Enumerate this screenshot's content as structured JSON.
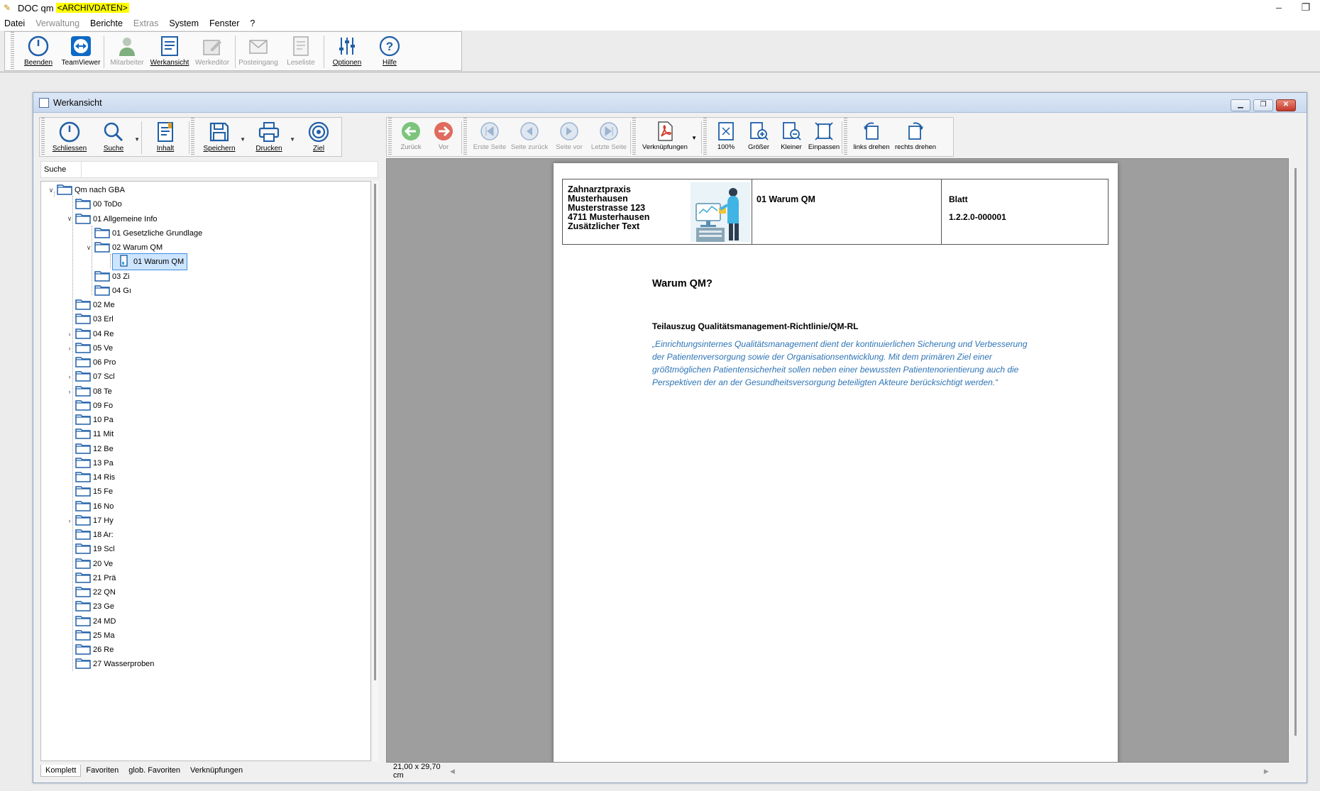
{
  "app": {
    "title": "DOC qm",
    "archive_badge": "<ARCHIVDATEN>",
    "window_controls": [
      "–",
      "❐"
    ]
  },
  "menu": [
    {
      "label": "Datei",
      "disabled": false
    },
    {
      "label": "Verwaltung",
      "disabled": true
    },
    {
      "label": "Berichte",
      "disabled": false
    },
    {
      "label": "Extras",
      "disabled": true
    },
    {
      "label": "System",
      "disabled": false
    },
    {
      "label": "Fenster",
      "disabled": false
    },
    {
      "label": "?",
      "disabled": false
    }
  ],
  "main_toolbar": {
    "beenden": "Beenden",
    "teamviewer": "TeamViewer",
    "mitarbeiter": "Mitarbeiter",
    "werkansicht": "Werkansicht",
    "werkeditor": "Werkeditor",
    "posteingang": "Posteingang",
    "leseliste": "Leseliste",
    "optionen": "Optionen",
    "hilfe": "Hilfe"
  },
  "child_window": {
    "title": "Werkansicht",
    "controls": {
      "minimize": "▁",
      "restore": "❐",
      "close": "✕"
    }
  },
  "left_toolbar": {
    "schliessen": "Schliessen",
    "suche": "Suche",
    "inhalt": "Inhalt",
    "speichern": "Speichern",
    "drucken": "Drucken",
    "ziel": "Ziel"
  },
  "right_toolbar": {
    "zurueck": "Zurück",
    "vor": "Vor",
    "erste_seite": "Erste Seite",
    "seite_zurueck": "Seite zurück",
    "seite_vor": "Seite vor",
    "letzte_seite": "Letzte Seite",
    "verknuepfungen": "Verknüpfungen",
    "zoom100": "100%",
    "groesser": "Größer",
    "kleiner": "Kleiner",
    "einpassen": "Einpassen",
    "links_drehen": "links drehen",
    "rechts_drehen": "rechts drehen"
  },
  "search": {
    "label": "Suche",
    "value": "",
    "placeholder": ""
  },
  "tree": [
    {
      "label": "Qm nach GBA",
      "level": 0,
      "expander": "v"
    },
    {
      "label": "00 ToDo",
      "level": 1,
      "expander": ""
    },
    {
      "label": "01 Allgemeine Info",
      "level": 1,
      "expander": "v"
    },
    {
      "label": "01 Gesetzliche Grundlage",
      "level": 2,
      "expander": ""
    },
    {
      "label": "02 Warum QM",
      "level": 2,
      "expander": "v"
    },
    {
      "label": "01 Warum QM",
      "level": 3,
      "expander": "",
      "doc": true,
      "selected": true
    },
    {
      "label": "03 Zi",
      "level": 2,
      "expander": ""
    },
    {
      "label": "04 Gı",
      "level": 2,
      "expander": ""
    },
    {
      "label": "02 Me",
      "level": 1,
      "expander": ""
    },
    {
      "label": "03 Erl",
      "level": 1,
      "expander": ""
    },
    {
      "label": "04 Re",
      "level": 1,
      "expander": ">"
    },
    {
      "label": "05 Ve",
      "level": 1,
      "expander": ">"
    },
    {
      "label": "06 Pro",
      "level": 1,
      "expander": ""
    },
    {
      "label": "07 Scl",
      "level": 1,
      "expander": ">"
    },
    {
      "label": "08 Te",
      "level": 1,
      "expander": ">"
    },
    {
      "label": "09 Fo",
      "level": 1,
      "expander": ""
    },
    {
      "label": "10 Pa",
      "level": 1,
      "expander": ""
    },
    {
      "label": "11 Mit",
      "level": 1,
      "expander": ""
    },
    {
      "label": "12 Be",
      "level": 1,
      "expander": ""
    },
    {
      "label": "13 Pa",
      "level": 1,
      "expander": ""
    },
    {
      "label": "14 Ris",
      "level": 1,
      "expander": ""
    },
    {
      "label": "15 Fe",
      "level": 1,
      "expander": ""
    },
    {
      "label": "16 No",
      "level": 1,
      "expander": ""
    },
    {
      "label": "17 Hy",
      "level": 1,
      "expander": ">"
    },
    {
      "label": "18 Ar:",
      "level": 1,
      "expander": ""
    },
    {
      "label": "19 Scl",
      "level": 1,
      "expander": ""
    },
    {
      "label": "20 Ve",
      "level": 1,
      "expander": ""
    },
    {
      "label": "21 Prä",
      "level": 1,
      "expander": ""
    },
    {
      "label": "22 QN",
      "level": 1,
      "expander": ""
    },
    {
      "label": "23 Ge",
      "level": 1,
      "expander": ""
    },
    {
      "label": "24 MD",
      "level": 1,
      "expander": ""
    },
    {
      "label": "25 Ma",
      "level": 1,
      "expander": ""
    },
    {
      "label": "26 Re",
      "level": 1,
      "expander": ""
    },
    {
      "label": "27 Wasserproben",
      "level": 1,
      "expander": ""
    }
  ],
  "left_tabs": [
    {
      "label": "Komplett",
      "active": true
    },
    {
      "label": "Favoriten",
      "active": false
    },
    {
      "label": "glob. Favoriten",
      "active": false
    },
    {
      "label": "Verknüpfungen",
      "active": false
    }
  ],
  "document": {
    "practice_lines": [
      "Zahnarztpraxis",
      "Musterhausen",
      "Musterstrasse 123",
      "4711 Musterhausen",
      "Zusätzlicher Text"
    ],
    "header_doc_title": "01 Warum QM",
    "blatt_label": "Blatt",
    "blatt_value": "1.2.2.0-000001",
    "heading": "Warum QM?",
    "subheading": "Teilauszug Qualitätsmanagement-Richtlinie/QM-RL",
    "quote": "„Einrichtungsinternes Qualitätsmanagement dient der kontinuierlichen Sicherung und Verbesserung der Patientenversorgung sowie der Organisationsentwicklung. Mit dem primären Ziel einer größtmöglichen Patientensicherheit sollen neben einer bewussten Patientenorientierung auch die Perspektiven der an der Gesundheitsversorgung beteiligten Akteure berücksichtigt werden.“",
    "quote_color": "#2e74b5"
  },
  "status": {
    "page_size": "21,00 x 29,70 cm"
  },
  "colors": {
    "selection_bg": "#cde5ff",
    "selection_border": "#3f8de0",
    "archive_highlight": "#ffff00",
    "back_green": "#7cc47c",
    "forward_red": "#e06a5e"
  }
}
